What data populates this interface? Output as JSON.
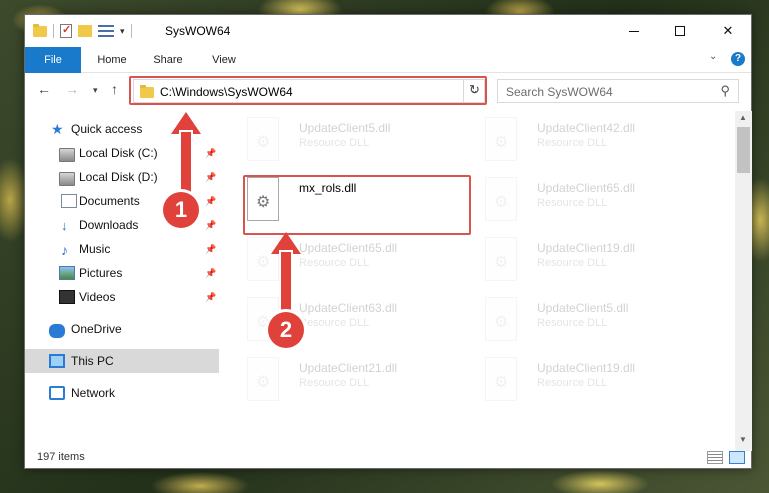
{
  "window": {
    "title": "SysWOW64",
    "controls": {
      "minimize": "—",
      "maximize": "□",
      "close": "✕"
    }
  },
  "ribbon": {
    "tabs": [
      "File",
      "Home",
      "Share",
      "View"
    ],
    "help": "?"
  },
  "address_bar": {
    "path": "C:\\Windows\\SysWOW64"
  },
  "search": {
    "placeholder": "Search SysWOW64"
  },
  "sidebar": {
    "quick_access": "Quick access",
    "items": [
      {
        "label": "Local Disk (C:)",
        "icon": "local-disk-icon",
        "pinned": true
      },
      {
        "label": "Local Disk (D:)",
        "icon": "local-disk-icon",
        "pinned": true
      },
      {
        "label": "Documents",
        "icon": "documents-icon",
        "pinned": true
      },
      {
        "label": "Downloads",
        "icon": "downloads-icon",
        "pinned": true
      },
      {
        "label": "Music",
        "icon": "music-icon",
        "pinned": true
      },
      {
        "label": "Pictures",
        "icon": "pictures-icon",
        "pinned": true
      },
      {
        "label": "Videos",
        "icon": "videos-icon",
        "pinned": true
      }
    ],
    "onedrive": "OneDrive",
    "this_pc": "This PC",
    "network": "Network"
  },
  "files": {
    "main_file": {
      "name": "mx_rols.dll"
    },
    "faded_col1": [
      {
        "name": "UpdateClient5.dll",
        "type": "Resource DLL"
      },
      {
        "name": "UpdateClient65.dll",
        "type": "Resource DLL"
      },
      {
        "name": "UpdateClient63.dll",
        "type": "Resource DLL"
      },
      {
        "name": "UpdateClient21.dll",
        "type": "Resource DLL"
      }
    ],
    "faded_col2": [
      {
        "name": "UpdateClient42.dll",
        "type": "Resource DLL"
      },
      {
        "name": "UpdateClient65.dll",
        "type": "Resource DLL"
      },
      {
        "name": "UpdateClient19.dll",
        "type": "Resource DLL"
      },
      {
        "name": "UpdateClient5.dll",
        "type": "Resource DLL"
      },
      {
        "name": "UpdateClient19.dll",
        "type": "Resource DLL"
      }
    ]
  },
  "status": {
    "item_count": "197 items"
  },
  "annotations": {
    "step1": "1",
    "step2": "2",
    "color": "#e0423b"
  },
  "colors": {
    "accent": "#1979ca",
    "highlight_box": "#d9544f"
  }
}
